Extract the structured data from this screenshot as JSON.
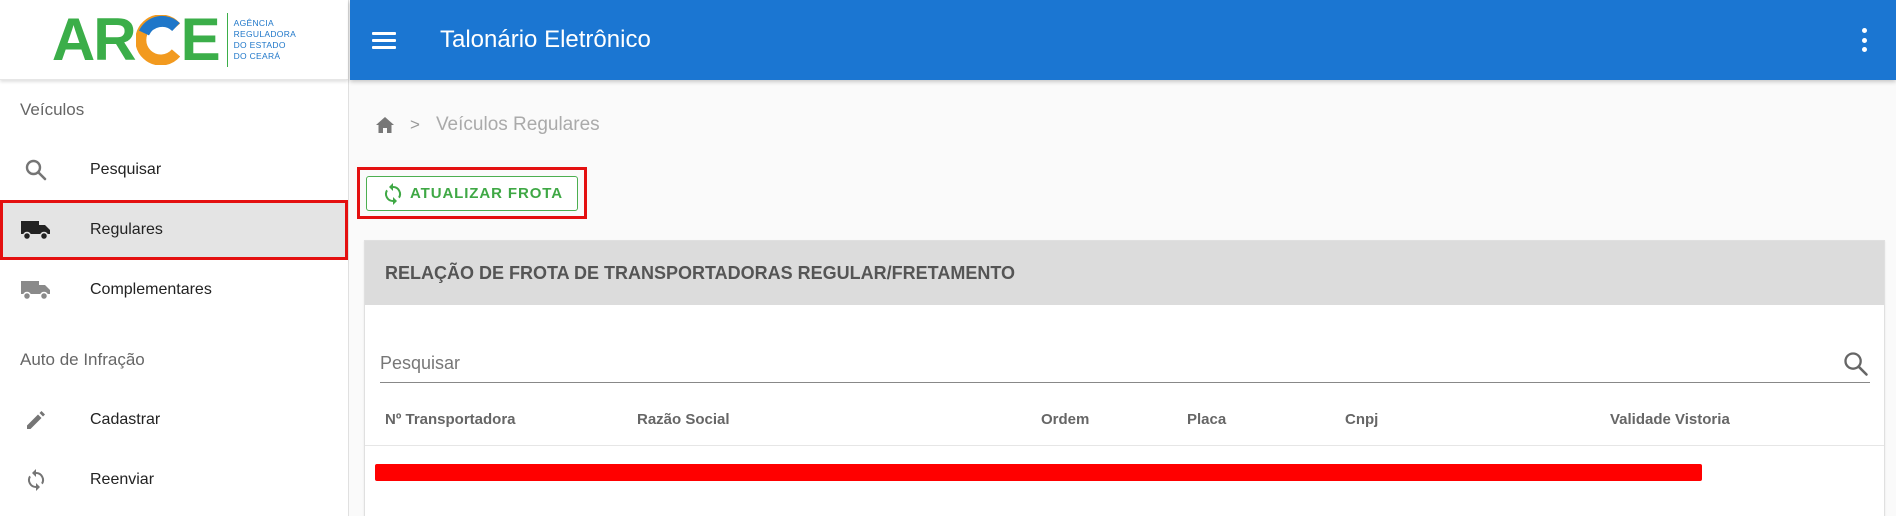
{
  "logo": {
    "word": [
      "AR",
      "C",
      "E"
    ],
    "subtitle": [
      "AGÊNCIA",
      "REGULADORA",
      "DO ESTADO",
      "DO CEARÁ"
    ]
  },
  "header": {
    "title": "Talonário Eletrônico"
  },
  "sidebar": {
    "sections": [
      {
        "label": "Veículos",
        "items": [
          {
            "label": "Pesquisar",
            "icon": "search-icon"
          },
          {
            "label": "Regulares",
            "icon": "truck-icon",
            "active": true
          },
          {
            "label": "Complementares",
            "icon": "truck-icon"
          }
        ]
      },
      {
        "label": "Auto de Infração",
        "items": [
          {
            "label": "Cadastrar",
            "icon": "pencil-icon"
          },
          {
            "label": "Reenviar",
            "icon": "sync-icon"
          }
        ]
      }
    ]
  },
  "breadcrumb": {
    "separator": ">",
    "current": "Veículos Regulares"
  },
  "actions": {
    "refresh_label": "ATUALIZAR FROTA"
  },
  "card": {
    "title": "RELAÇÃO DE FROTA DE TRANSPORTADORAS REGULAR/FRETAMENTO",
    "search_placeholder": "Pesquisar",
    "columns": [
      "Nº Transportadora",
      "Razão Social",
      "Ordem",
      "Placa",
      "Cnpj",
      "Validade Vistoria"
    ]
  },
  "colors": {
    "primary": "#1b76d2",
    "accent_green": "#3fa845",
    "highlight_red": "#e41010",
    "active_bg": "#e4e4e4"
  }
}
